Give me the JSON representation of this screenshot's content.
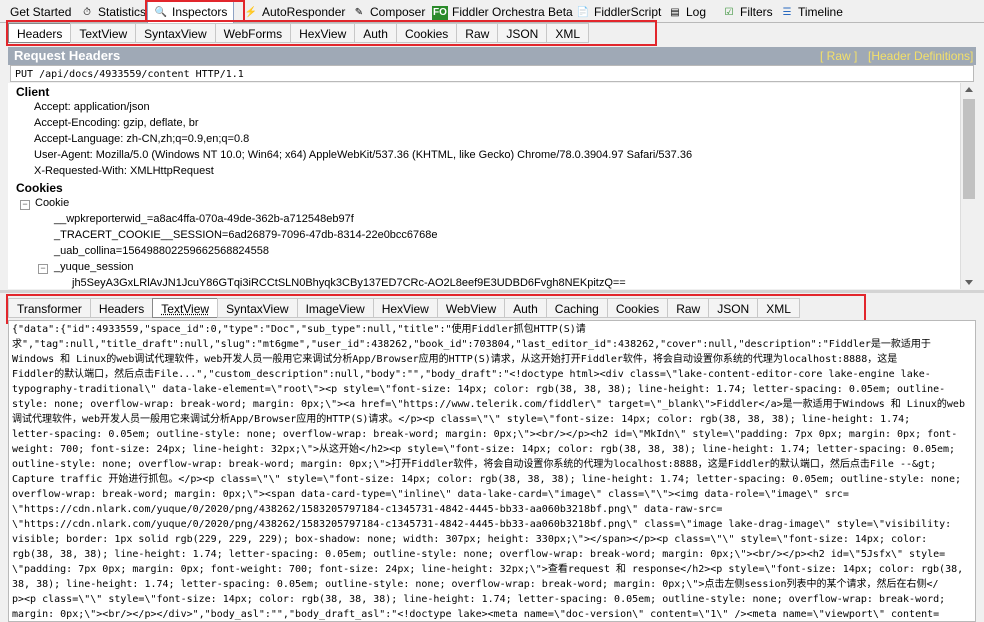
{
  "top_tabs": [
    {
      "label": "Get Started",
      "icon": "none"
    },
    {
      "label": "Statistics",
      "icon": "stopwatch-icon"
    },
    {
      "label": "Inspectors",
      "icon": "magnifier-icon"
    },
    {
      "label": "AutoResponder",
      "icon": "lightning-icon"
    },
    {
      "label": "Composer",
      "icon": "pencil-icon"
    },
    {
      "label": "Fiddler Orchestra Beta",
      "icon": "fo-icon"
    },
    {
      "label": "FiddlerScript",
      "icon": "script-icon"
    },
    {
      "label": "Log",
      "icon": "log-icon"
    },
    {
      "label": "Filters",
      "icon": "checkbox-icon"
    },
    {
      "label": "Timeline",
      "icon": "timeline-icon"
    }
  ],
  "request_tabs": [
    "Headers",
    "TextView",
    "SyntaxView",
    "WebForms",
    "HexView",
    "Auth",
    "Cookies",
    "Raw",
    "JSON",
    "XML"
  ],
  "request_headers": {
    "title": "Request Headers",
    "raw_link": "[ Raw ]",
    "defs_link": "[Header Definitions]",
    "request_line": "PUT /api/docs/4933559/content HTTP/1.1"
  },
  "tree": {
    "client_label": "Client",
    "client_items": [
      "Accept: application/json",
      "Accept-Encoding: gzip, deflate, br",
      "Accept-Language: zh-CN,zh;q=0.9,en;q=0.8",
      "User-Agent: Mozilla/5.0 (Windows NT 10.0; Win64; x64) AppleWebKit/537.36 (KHTML, like Gecko) Chrome/78.0.3904.97 Safari/537.36",
      "X-Requested-With: XMLHttpRequest"
    ],
    "cookies_label": "Cookies",
    "cookie_node": "Cookie",
    "cookie_items": [
      "__wpkreporterwid_=a8ac4ffa-070a-49de-362b-a712548eb97f",
      "_TRACERT_COOKIE__SESSION=6ad26879-7096-47db-8314-22e0bcc6768e",
      "_uab_collina=156498802259662568824558"
    ],
    "yuque_session_label": "_yuque_session",
    "yuque_session_value": "jh5SeyA3GxLRlAvJN1JcuY86GTqi3iRCCtSLN0Bhyqk3CBy137ED7CRc-AO2L8eef9E3UDBD6Fvgh8NEKpitzQ=="
  },
  "response_tabs": [
    "Transformer",
    "Headers",
    "TextView",
    "SyntaxView",
    "ImageView",
    "HexView",
    "WebView",
    "Auth",
    "Caching",
    "Cookies",
    "Raw",
    "JSON",
    "XML"
  ],
  "response_lines": [
    "{\"data\":{\"id\":4933559,\"space_id\":0,\"type\":\"Doc\",\"sub_type\":null,\"title\":\"使用Fiddler抓包HTTP(S)请",
    "求\",\"tag\":null,\"title_draft\":null,\"slug\":\"mt6gme\",\"user_id\":438262,\"book_id\":703804,\"last_editor_id\":438262,\"cover\":null,\"description\":\"Fiddler是一款适用于",
    "Windows 和 Linux的web调试代理软件，web开发人员一般用它来调试分析App/Browser应用的HTTP(S)请求，从这开始打开Fiddler软件，将会自动设置你系统的代理为localhost:8888，这是",
    "Fiddler的默认端口，然后点击File...\",\"custom_description\":null,\"body\":\"\",\"body_draft\":\"<!doctype html><div class=\\\"lake-content-editor-core lake-engine lake-",
    "typography-traditional\\\" data-lake-element=\\\"root\\\"><p style=\\\"font-size: 14px; color: rgb(38, 38, 38); line-height: 1.74; letter-spacing: 0.05em; outline-",
    "style: none; overflow-wrap: break-word; margin: 0px;\\\"><a href=\\\"https://www.telerik.com/fiddler\\\" target=\\\"_blank\\\">Fiddler</a>是一款适用于Windows 和 Linux的web",
    "调试代理软件，web开发人员一般用它来调试分析App/Browser应用的HTTP(S)请求。</p><p class=\\\"\\\" style=\\\"font-size: 14px; color: rgb(38, 38, 38); line-height: 1.74;",
    "letter-spacing: 0.05em; outline-style: none; overflow-wrap: break-word; margin: 0px;\\\"><br/></p><h2 id=\\\"MkIdn\\\" style=\\\"padding: 7px 0px; margin: 0px; font-",
    "weight: 700; font-size: 24px; line-height: 32px;\\\">从这开始</h2><p style=\\\"font-size: 14px; color: rgb(38, 38, 38); line-height: 1.74; letter-spacing: 0.05em;",
    "outline-style: none; overflow-wrap: break-word; margin: 0px;\\\">打开Fiddler软件，将会自动设置你系统的代理为localhost:8888，这是Fiddler的默认端口，然后点击File --&gt;",
    "Capture traffic 开始进行抓包。</p><p class=\\\"\\\" style=\\\"font-size: 14px; color: rgb(38, 38, 38); line-height: 1.74; letter-spacing: 0.05em; outline-style: none;",
    "overflow-wrap: break-word; margin: 0px;\\\"><span data-card-type=\\\"inline\\\" data-lake-card=\\\"image\\\" class=\\\"\\\"><img data-role=\\\"image\\\" src=",
    "\\\"https://cdn.nlark.com/yuque/0/2020/png/438262/1583205797184-c1345731-4842-4445-bb33-aa060b3218bf.png\\\" data-raw-src=",
    "\\\"https://cdn.nlark.com/yuque/0/2020/png/438262/1583205797184-c1345731-4842-4445-bb33-aa060b3218bf.png\\\" class=\\\"image lake-drag-image\\\" style=\\\"visibility:",
    "visible; border: 1px solid rgb(229, 229, 229); box-shadow: none; width: 307px; height: 330px;\\\"></span></p><p class=\\\"\\\" style=\\\"font-size: 14px; color:",
    "rgb(38, 38, 38); line-height: 1.74; letter-spacing: 0.05em; outline-style: none; overflow-wrap: break-word; margin: 0px;\\\"><br/></p><h2 id=\\\"5Jsfx\\\" style=",
    "\\\"padding: 7px 0px; margin: 0px; font-weight: 700; font-size: 24px; line-height: 32px;\\\">查看request 和 response</h2><p style=\\\"font-size: 14px; color: rgb(38,",
    "38, 38); line-height: 1.74; letter-spacing: 0.05em; outline-style: none; overflow-wrap: break-word; margin: 0px;\\\">点击左侧session列表中的某个请求，然后在右侧</",
    "p><p class=\\\"\\\" style=\\\"font-size: 14px; color: rgb(38, 38, 38); line-height: 1.74; letter-spacing: 0.05em; outline-style: none; overflow-wrap: break-word;",
    "margin: 0px;\\\"><br/></p></div>\",\"body_asl\":\"\",\"body_draft_asl\":\"<!doctype lake><meta name=\\\"doc-version\\\" content=\\\"1\\\" /><meta name=\\\"viewport\\\" content="
  ]
}
